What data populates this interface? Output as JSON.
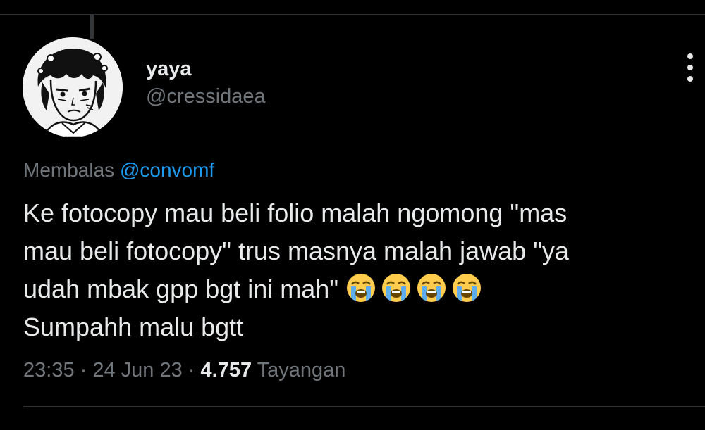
{
  "tweet": {
    "author": {
      "display_name": "yaya",
      "handle": "@cressidaea",
      "avatar_icon": "manga-character-avatar"
    },
    "reply_prefix": "Membalas",
    "reply_to": "@convomf",
    "text_lines": [
      "Ke fotocopy mau beli folio malah ngomong \"mas",
      "mau beli fotocopy\" trus masnya malah jawab \"ya",
      "udah mbak gpp bgt ini mah\" ",
      "Sumpahh malu bgtt"
    ],
    "emojis": [
      "loudly-crying-face",
      "loudly-crying-face",
      "loudly-crying-face",
      "loudly-crying-face"
    ],
    "time": "23:35",
    "date": "24 Jun 23",
    "views": "4.757",
    "views_label": "Tayangan",
    "separator": " · ",
    "more_icon": "more-vertical-icon"
  },
  "colors": {
    "background": "#000000",
    "text": "#e7e9ea",
    "secondary": "#71767b",
    "link": "#1d9bf0",
    "divider": "#2f3336"
  }
}
